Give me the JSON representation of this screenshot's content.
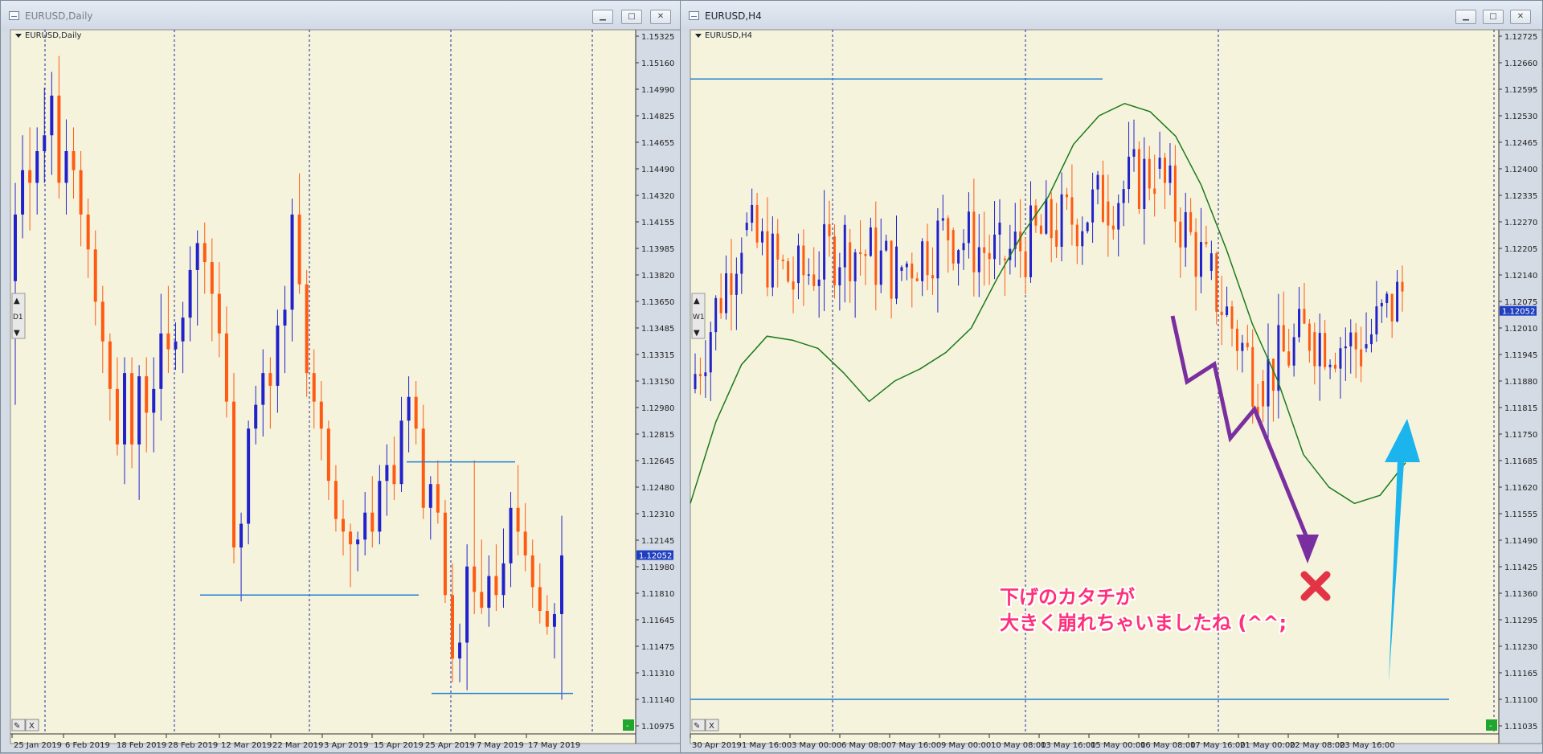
{
  "colors": {
    "background": "#f5f3dc",
    "bull": "#2222cc",
    "bear": "#ff5a12",
    "level": "#1e7fd2",
    "ma": "#1c7a1c",
    "grid": "#1a2aa0",
    "price_tag": "#1f3fc0",
    "annotation_arrow_down": "#7a2fa0",
    "annotation_arrow_up": "#1cb4ec",
    "annotation_cross": "#e23445",
    "annotation_text": "#ff2f7a"
  },
  "left_window": {
    "title": "EURUSD,Daily",
    "chart_label": "EURUSD,Daily",
    "current_price": "1.12052",
    "y_ticks": [
      "1.15325",
      "1.15160",
      "1.14990",
      "1.14825",
      "1.14655",
      "1.14490",
      "1.14320",
      "1.14155",
      "1.13985",
      "1.13820",
      "1.13650",
      "1.13485",
      "1.13315",
      "1.13150",
      "1.12980",
      "1.12815",
      "1.12645",
      "1.12480",
      "1.12310",
      "1.12145",
      "1.11980",
      "1.11810",
      "1.11645",
      "1.11475",
      "1.11310",
      "1.11140",
      "1.10975"
    ],
    "x_ticks": [
      "25 Jan 2019",
      "6 Feb 2019",
      "18 Feb 2019",
      "28 Feb 2019",
      "12 Mar 2019",
      "22 Mar 2019",
      "3 Apr 2019",
      "15 Apr 2019",
      "25 Apr 2019",
      "7 May 2019",
      "17 May 2019"
    ],
    "timeframe_label": "D1",
    "window_buttons": {
      "minimize": "▁",
      "maximize": "□",
      "close": "✕"
    },
    "corner_buttons": [
      "✎",
      "X"
    ],
    "status_mark": "-"
  },
  "right_window": {
    "title": "EURUSD,H4",
    "chart_label": "EURUSD,H4",
    "current_price": "1.12052",
    "y_ticks": [
      "1.12725",
      "1.12660",
      "1.12595",
      "1.12530",
      "1.12465",
      "1.12400",
      "1.12335",
      "1.12270",
      "1.12205",
      "1.12140",
      "1.12075",
      "1.12010",
      "1.11945",
      "1.11880",
      "1.11815",
      "1.11750",
      "1.11685",
      "1.11620",
      "1.11555",
      "1.11490",
      "1.11425",
      "1.11360",
      "1.11295",
      "1.11230",
      "1.11165",
      "1.11100",
      "1.11035"
    ],
    "x_ticks": [
      "30 Apr 2019",
      "1 May 16:00",
      "3 May 00:00",
      "6 May 08:00",
      "7 May 16:00",
      "9 May 00:00",
      "10 May 08:00",
      "13 May 16:00",
      "15 May 00:00",
      "16 May 08:00",
      "17 May 16:00",
      "21 May 00:00",
      "22 May 08:00",
      "23 May 16:00"
    ],
    "timeframe_label": "W1",
    "window_buttons": {
      "minimize": "▁",
      "maximize": "□",
      "close": "✕"
    },
    "corner_buttons": [
      "✎",
      "X"
    ],
    "status_mark": "-",
    "annotation": {
      "line1": "下げのカタチが",
      "line2": "大きく崩れちゃいましたね (^^;"
    }
  },
  "chart_data": [
    {
      "type": "candlestick",
      "symbol": "EURUSD",
      "timeframe": "Daily",
      "title": "EURUSD,Daily",
      "ylim": [
        1.10975,
        1.15325
      ],
      "x_labels": [
        "25 Jan 2019",
        "6 Feb 2019",
        "18 Feb 2019",
        "28 Feb 2019",
        "12 Mar 2019",
        "22 Mar 2019",
        "3 Apr 2019",
        "15 Apr 2019",
        "25 Apr 2019",
        "7 May 2019",
        "17 May 2019"
      ],
      "ohlc": [
        [
          1.1378,
          1.144,
          1.13,
          1.142
        ],
        [
          1.142,
          1.147,
          1.1405,
          1.1448
        ],
        [
          1.1448,
          1.1475,
          1.141,
          1.144
        ],
        [
          1.144,
          1.1475,
          1.142,
          1.146
        ],
        [
          1.146,
          1.15,
          1.144,
          1.147
        ],
        [
          1.147,
          1.151,
          1.1445,
          1.1495
        ],
        [
          1.1495,
          1.152,
          1.143,
          1.144
        ],
        [
          1.144,
          1.148,
          1.142,
          1.146
        ],
        [
          1.146,
          1.1475,
          1.143,
          1.1448
        ],
        [
          1.1448,
          1.146,
          1.14,
          1.142
        ],
        [
          1.142,
          1.143,
          1.138,
          1.1398
        ],
        [
          1.1398,
          1.141,
          1.135,
          1.1365
        ],
        [
          1.1365,
          1.1375,
          1.132,
          1.134
        ],
        [
          1.134,
          1.1345,
          1.129,
          1.131
        ],
        [
          1.131,
          1.133,
          1.1268,
          1.1275
        ],
        [
          1.1275,
          1.133,
          1.125,
          1.132
        ],
        [
          1.132,
          1.133,
          1.126,
          1.1275
        ],
        [
          1.1275,
          1.1325,
          1.124,
          1.1318
        ],
        [
          1.1318,
          1.133,
          1.127,
          1.1295
        ],
        [
          1.1295,
          1.133,
          1.127,
          1.131
        ],
        [
          1.131,
          1.137,
          1.129,
          1.1345
        ],
        [
          1.1345,
          1.1375,
          1.132,
          1.1335
        ],
        [
          1.1335,
          1.1352,
          1.1322,
          1.134
        ],
        [
          1.134,
          1.1365,
          1.132,
          1.1355
        ],
        [
          1.1355,
          1.14,
          1.134,
          1.1385
        ],
        [
          1.1385,
          1.141,
          1.135,
          1.1402
        ],
        [
          1.1402,
          1.1415,
          1.137,
          1.139
        ],
        [
          1.139,
          1.1405,
          1.134,
          1.137
        ],
        [
          1.137,
          1.139,
          1.133,
          1.1345
        ],
        [
          1.1345,
          1.1362,
          1.1292,
          1.1302
        ],
        [
          1.1302,
          1.132,
          1.12,
          1.121
        ],
        [
          1.121,
          1.1232,
          1.1176,
          1.1225
        ],
        [
          1.1225,
          1.129,
          1.1212,
          1.1285
        ],
        [
          1.1285,
          1.1312,
          1.1275,
          1.13
        ],
        [
          1.13,
          1.1335,
          1.128,
          1.132
        ],
        [
          1.132,
          1.133,
          1.1285,
          1.1312
        ],
        [
          1.1312,
          1.136,
          1.1295,
          1.135
        ],
        [
          1.135,
          1.1375,
          1.132,
          1.136
        ],
        [
          1.136,
          1.143,
          1.134,
          1.142
        ],
        [
          1.142,
          1.1446,
          1.137,
          1.1376
        ],
        [
          1.1376,
          1.1385,
          1.1305,
          1.132
        ],
        [
          1.132,
          1.1335,
          1.1285,
          1.1302
        ],
        [
          1.1302,
          1.1315,
          1.1265,
          1.1285
        ],
        [
          1.1285,
          1.129,
          1.124,
          1.1252
        ],
        [
          1.1252,
          1.1262,
          1.122,
          1.1228
        ],
        [
          1.1228,
          1.124,
          1.1205,
          1.122
        ],
        [
          1.122,
          1.1225,
          1.1185,
          1.1212
        ],
        [
          1.1212,
          1.122,
          1.1195,
          1.1215
        ],
        [
          1.1215,
          1.1245,
          1.1205,
          1.1232
        ],
        [
          1.1232,
          1.1255,
          1.121,
          1.122
        ],
        [
          1.122,
          1.1262,
          1.1212,
          1.1252
        ],
        [
          1.1252,
          1.1275,
          1.123,
          1.1262
        ],
        [
          1.1262,
          1.128,
          1.124,
          1.125
        ],
        [
          1.125,
          1.1305,
          1.1245,
          1.129
        ],
        [
          1.129,
          1.1318,
          1.127,
          1.1305
        ],
        [
          1.1305,
          1.1315,
          1.1275,
          1.1285
        ],
        [
          1.1285,
          1.13,
          1.1228,
          1.1235
        ],
        [
          1.1235,
          1.1255,
          1.1215,
          1.125
        ],
        [
          1.125,
          1.1265,
          1.1225,
          1.1232
        ],
        [
          1.1232,
          1.124,
          1.1175,
          1.118
        ],
        [
          1.118,
          1.12,
          1.1125,
          1.114
        ],
        [
          1.114,
          1.1162,
          1.1125,
          1.115
        ],
        [
          1.115,
          1.1212,
          1.112,
          1.1198
        ],
        [
          1.1198,
          1.1265,
          1.1168,
          1.1182
        ],
        [
          1.1182,
          1.1215,
          1.1168,
          1.1172
        ],
        [
          1.1172,
          1.1205,
          1.116,
          1.1192
        ],
        [
          1.1192,
          1.1212,
          1.117,
          1.118
        ],
        [
          1.118,
          1.1222,
          1.1172,
          1.12
        ],
        [
          1.12,
          1.1245,
          1.1185,
          1.1235
        ],
        [
          1.1235,
          1.1262,
          1.1205,
          1.122
        ],
        [
          1.122,
          1.1238,
          1.1195,
          1.1205
        ],
        [
          1.1205,
          1.1215,
          1.1172,
          1.1185
        ],
        [
          1.1185,
          1.12,
          1.1162,
          1.117
        ],
        [
          1.117,
          1.118,
          1.1155,
          1.116
        ],
        [
          1.116,
          1.1175,
          1.114,
          1.1168
        ],
        [
          1.1168,
          1.123,
          1.1114,
          1.1205
        ]
      ],
      "levels": [
        {
          "price": 1.1264,
          "from": "15 Apr 2019",
          "to": "7 May 2019"
        },
        {
          "price": 1.118,
          "from": "28 Feb 2019",
          "to": "25 Apr 2019"
        },
        {
          "price": 1.1118,
          "from": "25 Apr 2019",
          "to": "17 May 2019"
        }
      ],
      "grid": true
    },
    {
      "type": "candlestick",
      "symbol": "EURUSD",
      "timeframe": "H4",
      "title": "EURUSD,H4",
      "ylim": [
        1.11035,
        1.12725
      ],
      "x_labels": [
        "30 Apr 2019",
        "1 May 16:00",
        "3 May 00:00",
        "6 May 08:00",
        "7 May 16:00",
        "9 May 00:00",
        "10 May 08:00",
        "13 May 16:00",
        "15 May 00:00",
        "16 May 08:00",
        "17 May 16:00",
        "21 May 00:00",
        "22 May 08:00",
        "23 May 16:00"
      ],
      "ohlc_start": [
        1.1186,
        1.1225,
        1.1212,
        1.1222,
        1.1215,
        1.1225,
        1.1218,
        1.1225,
        1.1232,
        1.124,
        1.1215,
        1.1188,
        1.12,
        1.1196
      ],
      "series": [
        {
          "name": "Moving Average",
          "values": [
            1.1158,
            1.1178,
            1.1192,
            1.1199,
            1.1198,
            1.1196,
            1.119,
            1.1183,
            1.1188,
            1.1191,
            1.1195,
            1.1201,
            1.1213,
            1.1224,
            1.1233,
            1.1246,
            1.1253,
            1.1256,
            1.1254,
            1.1248,
            1.1236,
            1.122,
            1.1202,
            1.1188,
            1.117,
            1.1162,
            1.1158,
            1.116,
            1.1168
          ]
        }
      ],
      "levels": [
        {
          "price": 1.1262,
          "from": "30 Apr 2019",
          "to": "15 May 00:00"
        },
        {
          "price": 1.111,
          "from": "30 Apr 2019",
          "to": "23 May 16:00"
        }
      ],
      "grid": true
    }
  ]
}
